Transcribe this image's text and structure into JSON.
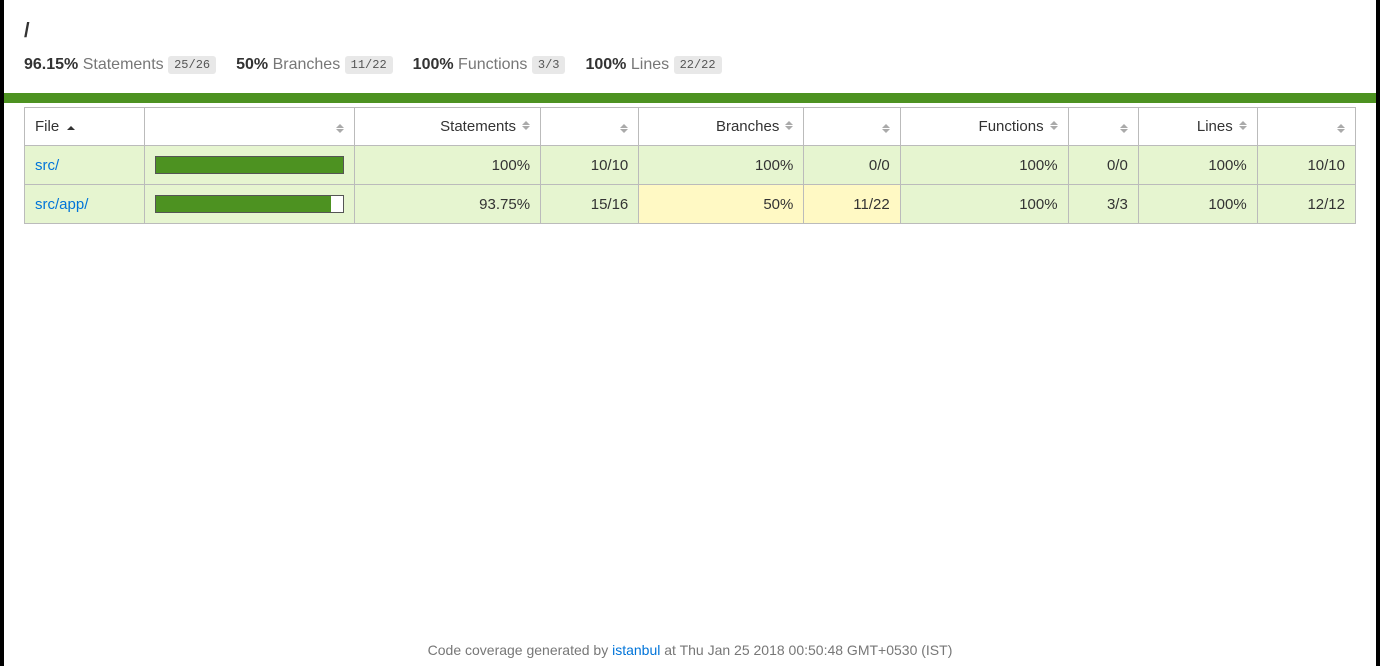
{
  "title": "/",
  "summary": {
    "statements": {
      "pct": "96.15%",
      "label": "Statements",
      "fraction": "25/26"
    },
    "branches": {
      "pct": "50%",
      "label": "Branches",
      "fraction": "11/22"
    },
    "functions": {
      "pct": "100%",
      "label": "Functions",
      "fraction": "3/3"
    },
    "lines": {
      "pct": "100%",
      "label": "Lines",
      "fraction": "22/22"
    }
  },
  "columns": {
    "file": "File",
    "statements": "Statements",
    "branches": "Branches",
    "functions": "Functions",
    "lines": "Lines"
  },
  "rows": [
    {
      "file": "src/",
      "bar_pct": "100",
      "statements_pct": "100%",
      "statements_abs": "10/10",
      "statements_cls": "high",
      "branches_pct": "100%",
      "branches_abs": "0/0",
      "branches_cls": "high",
      "functions_pct": "100%",
      "functions_abs": "0/0",
      "functions_cls": "high",
      "lines_pct": "100%",
      "lines_abs": "10/10",
      "lines_cls": "high"
    },
    {
      "file": "src/app/",
      "bar_pct": "93.75",
      "statements_pct": "93.75%",
      "statements_abs": "15/16",
      "statements_cls": "high",
      "branches_pct": "50%",
      "branches_abs": "11/22",
      "branches_cls": "medium",
      "functions_pct": "100%",
      "functions_abs": "3/3",
      "functions_cls": "high",
      "lines_pct": "100%",
      "lines_abs": "12/12",
      "lines_cls": "high"
    }
  ],
  "footer": {
    "prefix": "Code coverage generated by ",
    "link_text": "istanbul",
    "suffix": " at Thu Jan 25 2018 00:50:48 GMT+0530 (IST)"
  }
}
